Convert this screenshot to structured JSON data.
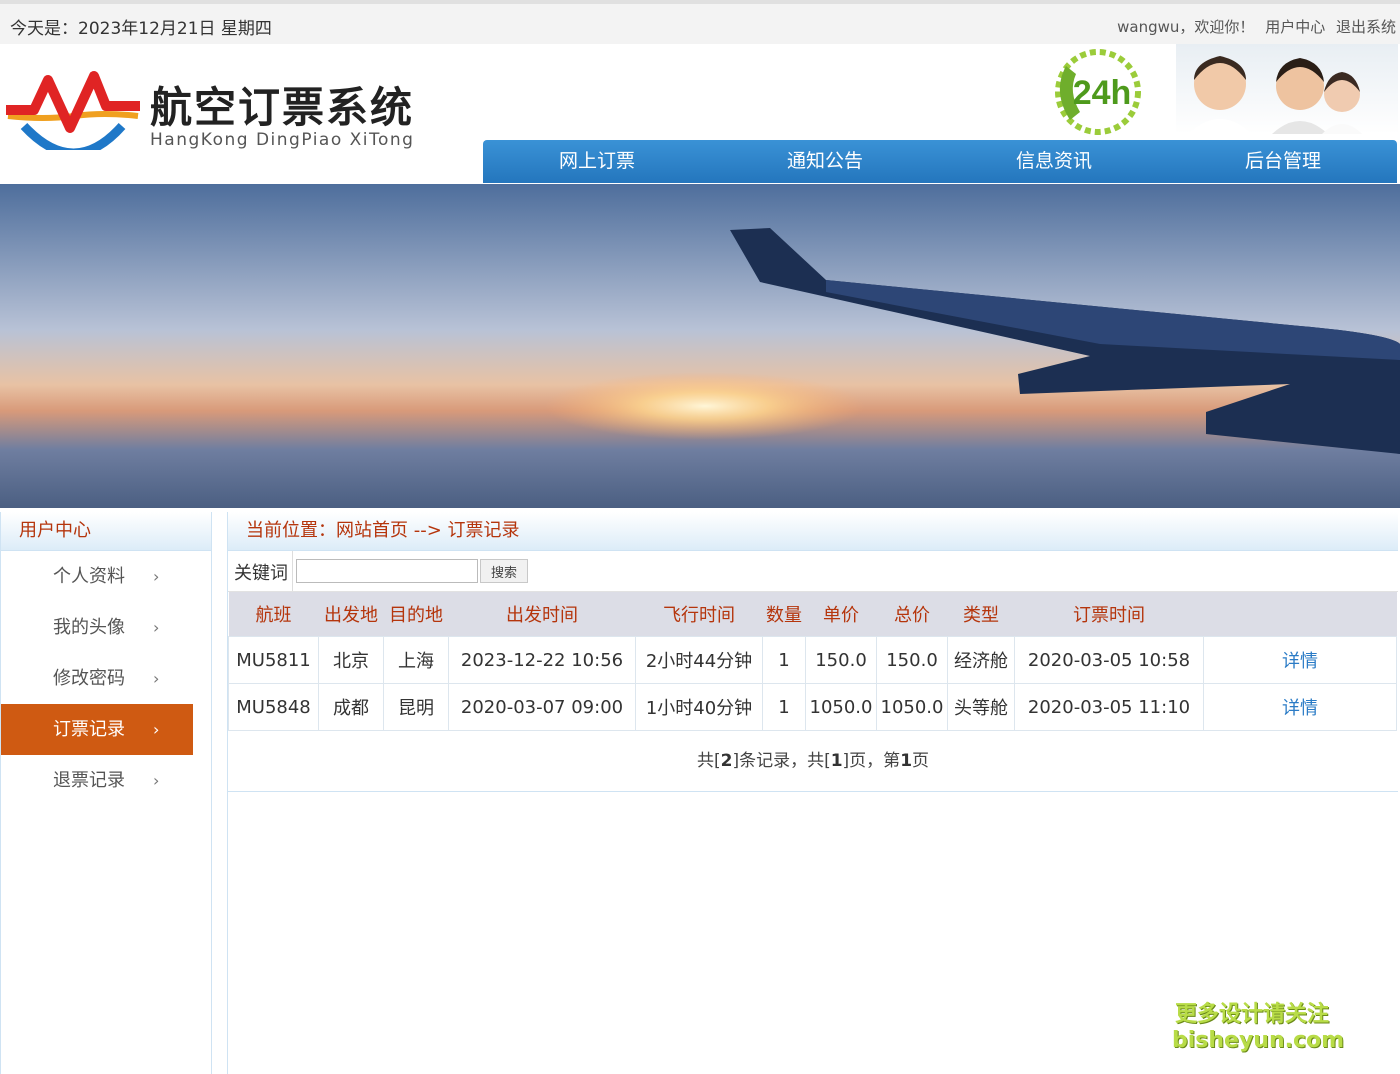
{
  "topbar": {
    "date": "今天是：2023年12月21日 星期四",
    "greeting": "wangwu，欢迎你！",
    "user_center": "用户中心",
    "logout": "退出系统"
  },
  "header": {
    "title": "航空订票系统",
    "subtitle": "HangKong DingPiao XiTong",
    "badge": "24h",
    "nav": [
      "网上订票",
      "通知公告",
      "信息资讯",
      "后台管理"
    ]
  },
  "sidebar": {
    "title": "用户中心",
    "items": [
      {
        "label": "个人资料",
        "active": false
      },
      {
        "label": "我的头像",
        "active": false
      },
      {
        "label": "修改密码",
        "active": false
      },
      {
        "label": "订票记录",
        "active": true
      },
      {
        "label": "退票记录",
        "active": false
      }
    ]
  },
  "main": {
    "breadcrumb": "当前位置：网站首页 --> 订票记录",
    "search_label": "关键词",
    "search_value": "",
    "search_button": "搜索",
    "columns": [
      "航班",
      "出发地",
      "目的地",
      "出发时间",
      "飞行时间",
      "数量",
      "单价",
      "总价",
      "类型",
      "订票时间",
      ""
    ],
    "rows": [
      [
        "MU5811",
        "北京",
        "上海",
        "2023-12-22 10:56",
        "2小时44分钟",
        "1",
        "150.0",
        "150.0",
        "经济舱",
        "2020-03-05 10:58",
        "详情"
      ],
      [
        "MU5848",
        "成都",
        "昆明",
        "2020-03-07 09:00",
        "1小时40分钟",
        "1",
        "1050.0",
        "1050.0",
        "头等舱",
        "2020-03-05 11:10",
        "详情"
      ]
    ],
    "pager": {
      "prefix": "共[",
      "total": "2",
      "mid1": "]条记录，共[",
      "pages": "1",
      "mid2": "]页，第",
      "current": "1",
      "suffix": "页"
    }
  },
  "watermark": {
    "line1": "更多设计请关注",
    "line2": "bisheyun.com"
  },
  "colors": {
    "nav_blue": "#2b82c9",
    "active_orange": "#cf5a12",
    "header_text_red": "#b5350c",
    "link_blue": "#2a7bc6"
  }
}
